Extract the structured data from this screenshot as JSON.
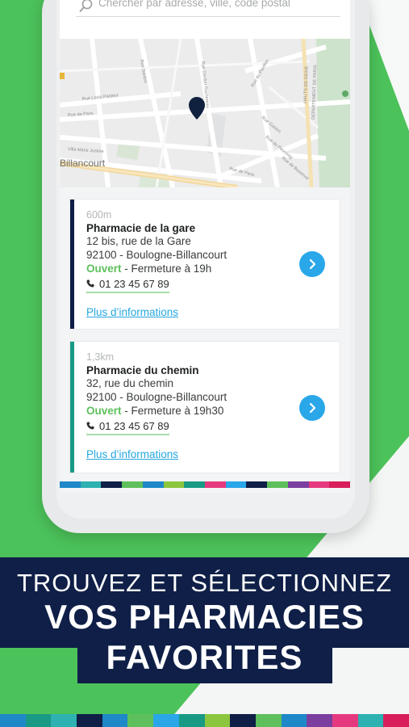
{
  "search": {
    "placeholder": "Chercher par adresse, ville, code postal"
  },
  "map": {
    "district_label": "Billancourt",
    "streets": [
      "Rue Danton",
      "Rue Louis Pasteur",
      "Rue de Paris",
      "Rue Denfert Rochereau",
      "Villa Marie Justine",
      "Rue du Pavillon",
      "Rue du Point du Jour",
      "Rue de Paris",
      "Rue du Pesconig",
      "Rue Gaston",
      "Rue de Buzenval",
      "Rue Denfert",
      "HAUTS-DE-SEINE",
      "DEPARTEMENT DE PARIS"
    ],
    "pin_icon": "map-pin-icon"
  },
  "pharmacies": [
    {
      "distance": "600m",
      "name": "Pharmacie de la gare",
      "street": "12 bis, rue de la Gare",
      "city": "92100 - Boulogne-Billancourt",
      "status": "Ouvert",
      "closing": " - Fermeture à 19h",
      "phone": "01 23 45 67 89",
      "more": "Plus d’informations",
      "bar_color": "#0f1f47"
    },
    {
      "distance": "1,3km",
      "name": "Pharmacie du chemin",
      "street": "32, rue du chemin",
      "city": "92100 - Boulogne-Billancourt",
      "status": "Ouvert",
      "closing": " - Fermeture à 19h30",
      "phone": "01 23 45 67 89",
      "more": "Plus d’informations",
      "bar_color": "#199a85"
    }
  ],
  "banner": {
    "line1": "TROUVEZ ET SÉLECTIONNEZ",
    "line2": "VOS PHARMACIES",
    "line3": "FAVORITES"
  },
  "colors": {
    "accent_blue": "#2aa7e9",
    "navy": "#0f1f47",
    "green": "#4cc25a",
    "open_green": "#5ec05c"
  }
}
